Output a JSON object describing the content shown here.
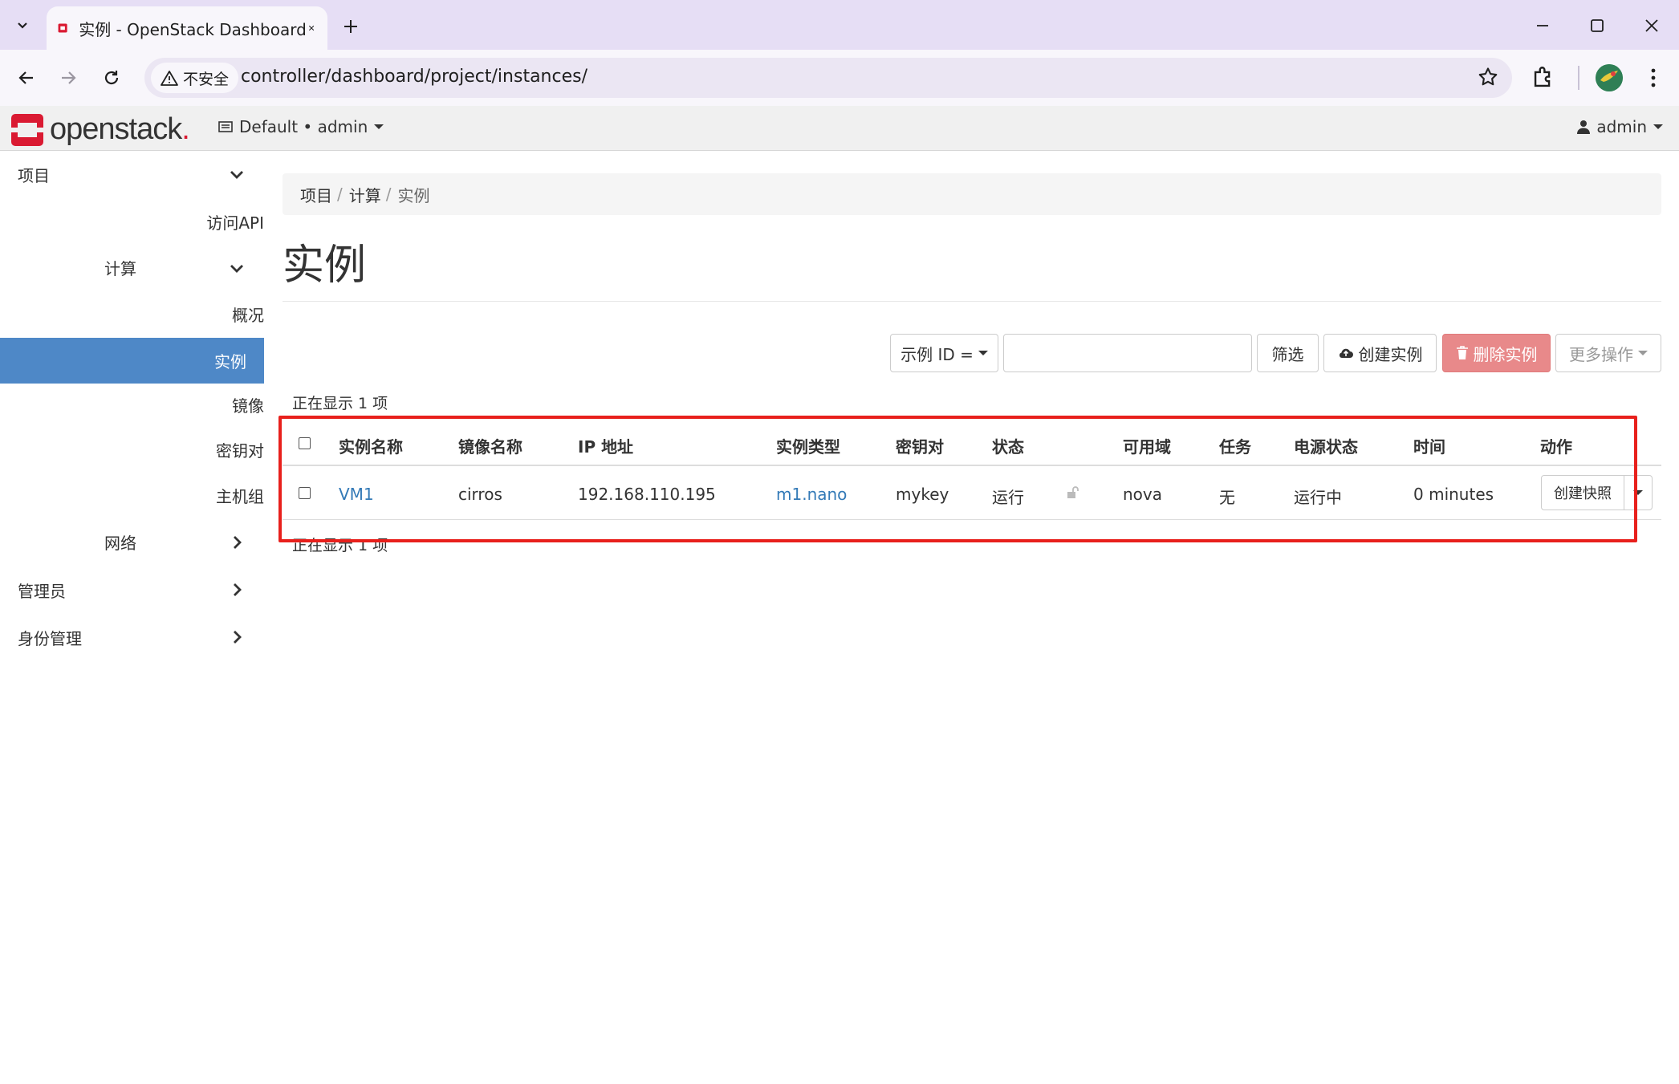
{
  "browser": {
    "tab_title": "实例 - OpenStack Dashboard",
    "security_label": "不安全",
    "url": "controller/dashboard/project/instances/"
  },
  "header": {
    "logo_text": "openstack",
    "logo_dot": ".",
    "context": "Default • admin",
    "user": "admin"
  },
  "sidebar": {
    "project": "项目",
    "api_access": "访问API",
    "compute": "计算",
    "overview": "概况",
    "instances": "实例",
    "images": "镜像",
    "keypairs": "密钥对",
    "server_groups": "主机组",
    "network": "网络",
    "admin": "管理员",
    "identity": "身份管理"
  },
  "breadcrumb": [
    "项目",
    "计算",
    "实例"
  ],
  "page_title": "实例",
  "actions": {
    "filter_select": "示例 ID =",
    "filter_button": "筛选",
    "create_button": "创建实例",
    "delete_button": "删除实例",
    "more_button": "更多操作"
  },
  "count_text": "正在显示 1 项",
  "table": {
    "headers": [
      "实例名称",
      "镜像名称",
      "IP 地址",
      "实例类型",
      "密钥对",
      "状态",
      "可用域",
      "任务",
      "电源状态",
      "时间",
      "动作"
    ],
    "rows": [
      {
        "name": "VM1",
        "image": "cirros",
        "ip": "192.168.110.195",
        "flavor": "m1.nano",
        "keypair": "mykey",
        "status": "运行",
        "zone": "nova",
        "task": "无",
        "power": "运行中",
        "time": "0 minutes",
        "action": "创建快照"
      }
    ]
  },
  "colors": {
    "active_nav": "#4e88c7",
    "link": "#337ab7",
    "danger": "#e8898a",
    "highlight_box": "#e8201c",
    "brand_red": "#da1a32"
  }
}
